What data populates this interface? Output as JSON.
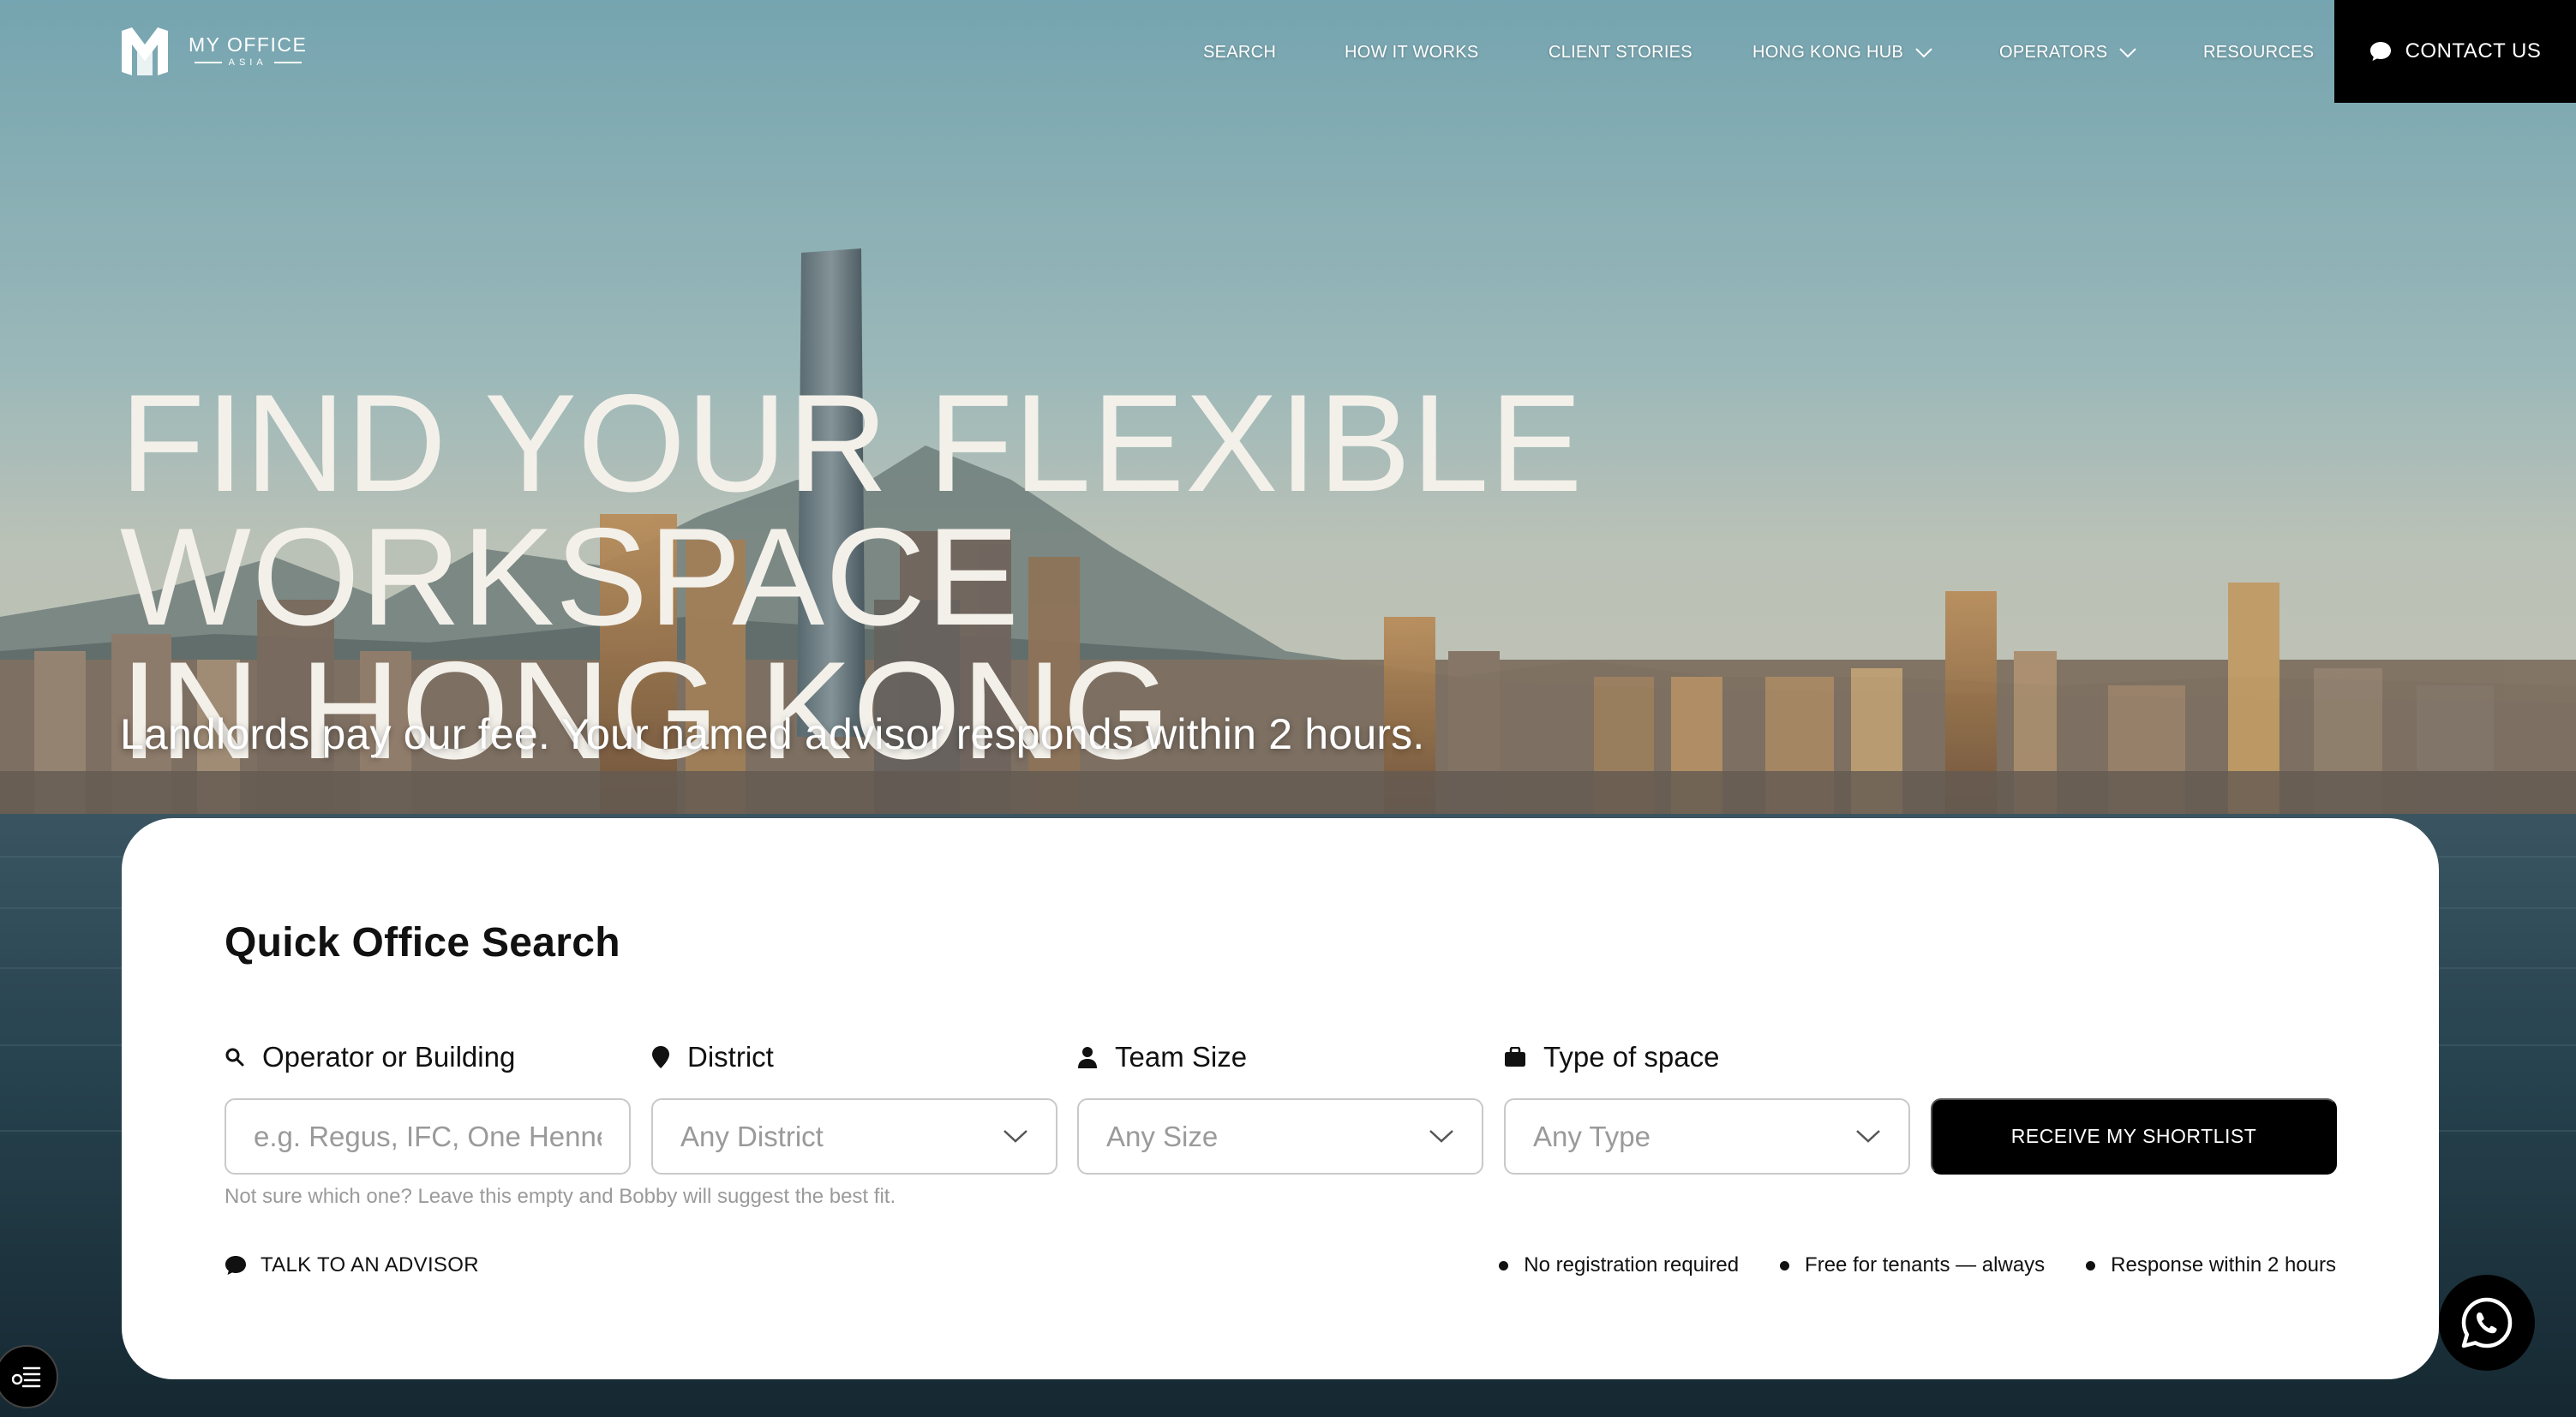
{
  "brand": {
    "name": "MY OFFICE",
    "sub": "ASIA",
    "logo_icon": "m-logo-icon"
  },
  "nav": {
    "items": [
      {
        "label": "SEARCH",
        "has_dropdown": false
      },
      {
        "label": "HOW IT WORKS",
        "has_dropdown": false
      },
      {
        "label": "CLIENT STORIES",
        "has_dropdown": false
      },
      {
        "label": "HONG KONG HUB",
        "has_dropdown": true
      },
      {
        "label": "OPERATORS",
        "has_dropdown": true
      },
      {
        "label": "RESOURCES",
        "has_dropdown": false
      }
    ],
    "contact_label": "CONTACT US",
    "contact_icon": "chat-bubble-icon"
  },
  "hero": {
    "title_line1": "FIND YOUR FLEXIBLE WORKSPACE",
    "title_line2": "IN HONG KONG",
    "subtitle": "Landlords pay our fee. Your named advisor responds within 2 hours."
  },
  "search": {
    "title": "Quick Office Search",
    "operator": {
      "label": "Operator or Building",
      "placeholder": "e.g. Regus, IFC, One Henne",
      "icon": "search-icon"
    },
    "district": {
      "label": "District",
      "value": "Any District",
      "icon": "location-pin-icon"
    },
    "team_size": {
      "label": "Team Size",
      "value": "Any Size",
      "icon": "person-icon"
    },
    "space_type": {
      "label": "Type of space",
      "value": "Any Type",
      "icon": "briefcase-icon"
    },
    "submit_label": "RECEIVE MY SHORTLIST",
    "hint": "Not sure which one? Leave this empty and Bobby will suggest the best fit.",
    "advisor_label": "TALK TO AN ADVISOR",
    "badges": [
      "No registration required",
      "Free for tenants — always",
      "Response within 2 hours"
    ]
  },
  "floating": {
    "whatsapp_icon": "whatsapp-icon",
    "accessibility_icon": "accessibility-menu-icon"
  },
  "colors": {
    "primary": "#000000",
    "hero_text": "#f3f0ea",
    "card_bg": "#ffffff",
    "placeholder": "#9a9a9a"
  }
}
